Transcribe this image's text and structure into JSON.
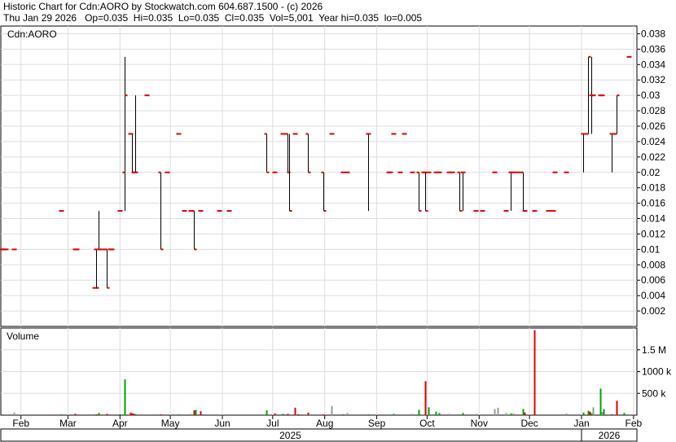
{
  "header": {
    "line1": "Historic Chart for Cdn:AORO by Stockwatch.com 604.687.1500 - (c) 2026",
    "line2": "Thu Jan 29 2026   Op=0.035  Hi=0.035  Lo=0.035  Cl=0.035  Vol=5,001  Year hi=0.035  lo=0.005"
  },
  "chart_data": {
    "type": "ohlc",
    "title": "Historic Chart for Cdn:AORO by Stockwatch.com 604.687.1500 - (c) 2026",
    "price_panel_label": "Cdn:AORO",
    "volume_panel_label": "Volume",
    "price_axis": {
      "ylim": [
        0,
        0.039
      ],
      "ticks": [
        "0.002",
        "0.004",
        "0.006",
        "0.008",
        "0.01",
        "0.012",
        "0.014",
        "0.016",
        "0.018",
        "0.02",
        "0.022",
        "0.024",
        "0.026",
        "0.028",
        "0.03",
        "0.032",
        "0.034",
        "0.036",
        "0.038"
      ]
    },
    "volume_axis": {
      "ylim": [
        0,
        2000000
      ],
      "ticks": [
        {
          "value": 500000,
          "label": "500 k"
        },
        {
          "value": 1000000,
          "label": "1000 k"
        },
        {
          "value": 1500000,
          "label": "1.5 M"
        }
      ]
    },
    "x_axis": {
      "start": "2025-01-20",
      "end": "2026-02-03",
      "months": [
        {
          "label": "Feb",
          "date": "2025-02-01"
        },
        {
          "label": "Mar",
          "date": "2025-03-01"
        },
        {
          "label": "Apr",
          "date": "2025-04-01"
        },
        {
          "label": "May",
          "date": "2025-05-01"
        },
        {
          "label": "Jun",
          "date": "2025-06-01"
        },
        {
          "label": "Jul",
          "date": "2025-07-01"
        },
        {
          "label": "Aug",
          "date": "2025-08-01"
        },
        {
          "label": "Sep",
          "date": "2025-09-01"
        },
        {
          "label": "Oct",
          "date": "2025-10-01"
        },
        {
          "label": "Nov",
          "date": "2025-11-01"
        },
        {
          "label": "Dec",
          "date": "2025-12-01"
        },
        {
          "label": "Jan",
          "date": "2026-01-01"
        },
        {
          "label": "Feb",
          "date": "2026-02-01"
        }
      ],
      "years": [
        {
          "label": "2025",
          "from": "2025-01-20",
          "to": "2025-12-31"
        },
        {
          "label": "2026",
          "from": "2026-01-01",
          "to": "2026-02-03"
        }
      ]
    },
    "grid": true,
    "colors": {
      "up": "#00a000",
      "down": "#e00000",
      "bar": "#000000",
      "grid": "#dddddd"
    },
    "bars": [
      {
        "date": "2025-01-20",
        "o": 0.01,
        "h": 0.01,
        "l": 0.01,
        "c": 0.01
      },
      {
        "date": "2025-01-21",
        "o": 0.01,
        "h": 0.01,
        "l": 0.01,
        "c": 0.01
      },
      {
        "date": "2025-01-22",
        "o": 0.01,
        "h": 0.01,
        "l": 0.01,
        "c": 0.01
      },
      {
        "date": "2025-01-23",
        "o": 0.01,
        "h": 0.01,
        "l": 0.01,
        "c": 0.01
      },
      {
        "date": "2025-01-28",
        "o": 0.01,
        "h": 0.01,
        "l": 0.01,
        "c": 0.01
      },
      {
        "date": "2025-02-25",
        "o": 0.015,
        "h": 0.015,
        "l": 0.015,
        "c": 0.015
      },
      {
        "date": "2025-03-05",
        "o": 0.01,
        "h": 0.01,
        "l": 0.01,
        "c": 0.01
      },
      {
        "date": "2025-03-06",
        "o": 0.01,
        "h": 0.01,
        "l": 0.01,
        "c": 0.01
      },
      {
        "date": "2025-03-17",
        "o": 0.005,
        "h": 0.005,
        "l": 0.005,
        "c": 0.005
      },
      {
        "date": "2025-03-18",
        "o": 0.01,
        "h": 0.01,
        "l": 0.005,
        "c": 0.005
      },
      {
        "date": "2025-03-19",
        "o": 0.01,
        "h": 0.015,
        "l": 0.01,
        "c": 0.01
      },
      {
        "date": "2025-03-21",
        "o": 0.01,
        "h": 0.01,
        "l": 0.01,
        "c": 0.01
      },
      {
        "date": "2025-03-24",
        "o": 0.01,
        "h": 0.01,
        "l": 0.005,
        "c": 0.005
      },
      {
        "date": "2025-03-26",
        "o": 0.01,
        "h": 0.01,
        "l": 0.01,
        "c": 0.01
      },
      {
        "date": "2025-03-27",
        "o": 0.01,
        "h": 0.01,
        "l": 0.01,
        "c": 0.01
      },
      {
        "date": "2025-04-01",
        "o": 0.015,
        "h": 0.015,
        "l": 0.015,
        "c": 0.015
      },
      {
        "date": "2025-04-04",
        "o": 0.02,
        "h": 0.035,
        "l": 0.015,
        "c": 0.03
      },
      {
        "date": "2025-04-07",
        "o": 0.025,
        "h": 0.025,
        "l": 0.025,
        "c": 0.025
      },
      {
        "date": "2025-04-08",
        "o": 0.025,
        "h": 0.025,
        "l": 0.02,
        "c": 0.02
      },
      {
        "date": "2025-04-09",
        "o": 0.02,
        "h": 0.02,
        "l": 0.02,
        "c": 0.02
      },
      {
        "date": "2025-04-10",
        "o": 0.02,
        "h": 0.03,
        "l": 0.02,
        "c": 0.02
      },
      {
        "date": "2025-04-17",
        "o": 0.03,
        "h": 0.03,
        "l": 0.03,
        "c": 0.03
      },
      {
        "date": "2025-04-25",
        "o": 0.02,
        "h": 0.02,
        "l": 0.01,
        "c": 0.01
      },
      {
        "date": "2025-04-29",
        "o": 0.02,
        "h": 0.02,
        "l": 0.02,
        "c": 0.02
      },
      {
        "date": "2025-05-06",
        "o": 0.025,
        "h": 0.025,
        "l": 0.025,
        "c": 0.025
      },
      {
        "date": "2025-05-09",
        "o": 0.015,
        "h": 0.015,
        "l": 0.015,
        "c": 0.015
      },
      {
        "date": "2025-05-13",
        "o": 0.015,
        "h": 0.015,
        "l": 0.015,
        "c": 0.015
      },
      {
        "date": "2025-05-15",
        "o": 0.015,
        "h": 0.015,
        "l": 0.01,
        "c": 0.01
      },
      {
        "date": "2025-05-19",
        "o": 0.015,
        "h": 0.015,
        "l": 0.015,
        "c": 0.015
      },
      {
        "date": "2025-05-30",
        "o": 0.015,
        "h": 0.015,
        "l": 0.015,
        "c": 0.015
      },
      {
        "date": "2025-06-05",
        "o": 0.015,
        "h": 0.015,
        "l": 0.015,
        "c": 0.015
      },
      {
        "date": "2025-06-27",
        "o": 0.025,
        "h": 0.025,
        "l": 0.02,
        "c": 0.02
      },
      {
        "date": "2025-07-02",
        "o": 0.02,
        "h": 0.02,
        "l": 0.02,
        "c": 0.02
      },
      {
        "date": "2025-07-07",
        "o": 0.025,
        "h": 0.025,
        "l": 0.025,
        "c": 0.025
      },
      {
        "date": "2025-07-10",
        "o": 0.025,
        "h": 0.025,
        "l": 0.02,
        "c": 0.02
      },
      {
        "date": "2025-07-11",
        "o": 0.02,
        "h": 0.025,
        "l": 0.015,
        "c": 0.015
      },
      {
        "date": "2025-07-14",
        "o": 0.025,
        "h": 0.025,
        "l": 0.025,
        "c": 0.025
      },
      {
        "date": "2025-07-22",
        "o": 0.025,
        "h": 0.025,
        "l": 0.02,
        "c": 0.02
      },
      {
        "date": "2025-07-31",
        "o": 0.02,
        "h": 0.02,
        "l": 0.015,
        "c": 0.015
      },
      {
        "date": "2025-08-05",
        "o": 0.025,
        "h": 0.025,
        "l": 0.025,
        "c": 0.025
      },
      {
        "date": "2025-08-12",
        "o": 0.02,
        "h": 0.02,
        "l": 0.02,
        "c": 0.02
      },
      {
        "date": "2025-08-14",
        "o": 0.02,
        "h": 0.02,
        "l": 0.02,
        "c": 0.02
      },
      {
        "date": "2025-08-27",
        "o": 0.025,
        "h": 0.025,
        "l": 0.015,
        "c": 0.025
      },
      {
        "date": "2025-09-11",
        "o": 0.025,
        "h": 0.025,
        "l": 0.025,
        "c": 0.025
      },
      {
        "date": "2025-09-08",
        "o": 0.02,
        "h": 0.02,
        "l": 0.02,
        "c": 0.02
      },
      {
        "date": "2025-09-09",
        "o": 0.02,
        "h": 0.02,
        "l": 0.02,
        "c": 0.02
      },
      {
        "date": "2025-09-15",
        "o": 0.02,
        "h": 0.02,
        "l": 0.02,
        "c": 0.02
      },
      {
        "date": "2025-09-17",
        "o": 0.025,
        "h": 0.025,
        "l": 0.025,
        "c": 0.025
      },
      {
        "date": "2025-09-22",
        "o": 0.02,
        "h": 0.02,
        "l": 0.02,
        "c": 0.02
      },
      {
        "date": "2025-09-26",
        "o": 0.02,
        "h": 0.02,
        "l": 0.015,
        "c": 0.015
      },
      {
        "date": "2025-09-29",
        "o": 0.02,
        "h": 0.02,
        "l": 0.02,
        "c": 0.02
      },
      {
        "date": "2025-09-30",
        "o": 0.02,
        "h": 0.02,
        "l": 0.015,
        "c": 0.015
      },
      {
        "date": "2025-10-02",
        "o": 0.02,
        "h": 0.02,
        "l": 0.02,
        "c": 0.02
      },
      {
        "date": "2025-10-06",
        "o": 0.02,
        "h": 0.02,
        "l": 0.02,
        "c": 0.02
      },
      {
        "date": "2025-10-08",
        "o": 0.02,
        "h": 0.02,
        "l": 0.02,
        "c": 0.02
      },
      {
        "date": "2025-10-14",
        "o": 0.02,
        "h": 0.02,
        "l": 0.02,
        "c": 0.02
      },
      {
        "date": "2025-10-16",
        "o": 0.02,
        "h": 0.02,
        "l": 0.02,
        "c": 0.02
      },
      {
        "date": "2025-10-20",
        "o": 0.02,
        "h": 0.02,
        "l": 0.015,
        "c": 0.015
      },
      {
        "date": "2025-10-22",
        "o": 0.02,
        "h": 0.02,
        "l": 0.015,
        "c": 0.02
      },
      {
        "date": "2025-10-30",
        "o": 0.015,
        "h": 0.015,
        "l": 0.015,
        "c": 0.015
      },
      {
        "date": "2025-11-03",
        "o": 0.015,
        "h": 0.015,
        "l": 0.015,
        "c": 0.015
      },
      {
        "date": "2025-11-10",
        "o": 0.02,
        "h": 0.02,
        "l": 0.02,
        "c": 0.02
      },
      {
        "date": "2025-11-17",
        "o": 0.015,
        "h": 0.015,
        "l": 0.015,
        "c": 0.015
      },
      {
        "date": "2025-11-20",
        "o": 0.02,
        "h": 0.02,
        "l": 0.015,
        "c": 0.02
      },
      {
        "date": "2025-11-21",
        "o": 0.02,
        "h": 0.02,
        "l": 0.02,
        "c": 0.02
      },
      {
        "date": "2025-11-24",
        "o": 0.02,
        "h": 0.02,
        "l": 0.02,
        "c": 0.02
      },
      {
        "date": "2025-11-27",
        "o": 0.02,
        "h": 0.02,
        "l": 0.015,
        "c": 0.015
      },
      {
        "date": "2025-11-28",
        "o": 0.015,
        "h": 0.015,
        "l": 0.015,
        "c": 0.015
      },
      {
        "date": "2025-12-04",
        "o": 0.015,
        "h": 0.015,
        "l": 0.015,
        "c": 0.015
      },
      {
        "date": "2025-12-12",
        "o": 0.015,
        "h": 0.015,
        "l": 0.015,
        "c": 0.015
      },
      {
        "date": "2025-12-15",
        "o": 0.015,
        "h": 0.015,
        "l": 0.015,
        "c": 0.015
      },
      {
        "date": "2025-12-16",
        "o": 0.02,
        "h": 0.02,
        "l": 0.02,
        "c": 0.02
      },
      {
        "date": "2025-12-23",
        "o": 0.02,
        "h": 0.02,
        "l": 0.02,
        "c": 0.02
      },
      {
        "date": "2026-01-02",
        "o": 0.025,
        "h": 0.025,
        "l": 0.02,
        "c": 0.025
      },
      {
        "date": "2026-01-05",
        "o": 0.025,
        "h": 0.035,
        "l": 0.025,
        "c": 0.035
      },
      {
        "date": "2026-01-07",
        "o": 0.03,
        "h": 0.035,
        "l": 0.025,
        "c": 0.03
      },
      {
        "date": "2026-01-08",
        "o": 0.03,
        "h": 0.03,
        "l": 0.03,
        "c": 0.03
      },
      {
        "date": "2026-01-12",
        "o": 0.03,
        "h": 0.03,
        "l": 0.03,
        "c": 0.03
      },
      {
        "date": "2026-01-13",
        "o": 0.03,
        "h": 0.03,
        "l": 0.03,
        "c": 0.03
      },
      {
        "date": "2026-01-19",
        "o": 0.025,
        "h": 0.025,
        "l": 0.02,
        "c": 0.025
      },
      {
        "date": "2026-01-22",
        "o": 0.025,
        "h": 0.03,
        "l": 0.025,
        "c": 0.03
      },
      {
        "date": "2026-01-29",
        "o": 0.035,
        "h": 0.035,
        "l": 0.035,
        "c": 0.035
      }
    ],
    "volumes": [
      {
        "date": "2025-01-23",
        "v": 20000,
        "dir": "flat"
      },
      {
        "date": "2025-01-28",
        "v": 60000,
        "dir": "flat"
      },
      {
        "date": "2025-02-25",
        "v": 20000,
        "dir": "up"
      },
      {
        "date": "2025-03-05",
        "v": 30000,
        "dir": "down"
      },
      {
        "date": "2025-03-18",
        "v": 20000,
        "dir": "down"
      },
      {
        "date": "2025-03-19",
        "v": 50000,
        "dir": "up"
      },
      {
        "date": "2025-03-21",
        "v": 25000,
        "dir": "flat"
      },
      {
        "date": "2025-03-24",
        "v": 30000,
        "dir": "down"
      },
      {
        "date": "2025-04-01",
        "v": 20000,
        "dir": "up"
      },
      {
        "date": "2025-04-04",
        "v": 820000,
        "dir": "up"
      },
      {
        "date": "2025-04-07",
        "v": 60000,
        "dir": "down"
      },
      {
        "date": "2025-04-08",
        "v": 40000,
        "dir": "down"
      },
      {
        "date": "2025-04-09",
        "v": 30000,
        "dir": "down"
      },
      {
        "date": "2025-04-10",
        "v": 25000,
        "dir": "up"
      },
      {
        "date": "2025-04-25",
        "v": 20000,
        "dir": "down"
      },
      {
        "date": "2025-05-06",
        "v": 20000,
        "dir": "up"
      },
      {
        "date": "2025-05-13",
        "v": 30000,
        "dir": "flat"
      },
      {
        "date": "2025-05-15",
        "v": 110000,
        "dir": "down"
      },
      {
        "date": "2025-05-16",
        "v": 120000,
        "dir": "up"
      },
      {
        "date": "2025-05-19",
        "v": 90000,
        "dir": "down"
      },
      {
        "date": "2025-05-30",
        "v": 20000,
        "dir": "flat"
      },
      {
        "date": "2025-06-27",
        "v": 110000,
        "dir": "up"
      },
      {
        "date": "2025-07-02",
        "v": 40000,
        "dir": "down"
      },
      {
        "date": "2025-07-07",
        "v": 30000,
        "dir": "up"
      },
      {
        "date": "2025-07-10",
        "v": 30000,
        "dir": "down"
      },
      {
        "date": "2025-07-14",
        "v": 170000,
        "dir": "down"
      },
      {
        "date": "2025-07-16",
        "v": 20000,
        "dir": "down"
      },
      {
        "date": "2025-07-22",
        "v": 60000,
        "dir": "down"
      },
      {
        "date": "2025-07-31",
        "v": 20000,
        "dir": "down"
      },
      {
        "date": "2025-08-05",
        "v": 210000,
        "dir": "flat"
      },
      {
        "date": "2025-08-12",
        "v": 20000,
        "dir": "up"
      },
      {
        "date": "2025-08-14",
        "v": 50000,
        "dir": "flat"
      },
      {
        "date": "2025-08-27",
        "v": 20000,
        "dir": "up"
      },
      {
        "date": "2025-09-11",
        "v": 30000,
        "dir": "up"
      },
      {
        "date": "2025-09-22",
        "v": 30000,
        "dir": "flat"
      },
      {
        "date": "2025-09-26",
        "v": 120000,
        "dir": "up"
      },
      {
        "date": "2025-09-29",
        "v": 20000,
        "dir": "flat"
      },
      {
        "date": "2025-09-30",
        "v": 780000,
        "dir": "down"
      },
      {
        "date": "2025-10-02",
        "v": 180000,
        "dir": "up"
      },
      {
        "date": "2025-10-06",
        "v": 80000,
        "dir": "up"
      },
      {
        "date": "2025-10-08",
        "v": 50000,
        "dir": "up"
      },
      {
        "date": "2025-10-14",
        "v": 30000,
        "dir": "flat"
      },
      {
        "date": "2025-10-22",
        "v": 50000,
        "dir": "up"
      },
      {
        "date": "2025-10-30",
        "v": 30000,
        "dir": "flat"
      },
      {
        "date": "2025-11-10",
        "v": 140000,
        "dir": "flat"
      },
      {
        "date": "2025-11-12",
        "v": 170000,
        "dir": "flat"
      },
      {
        "date": "2025-11-17",
        "v": 50000,
        "dir": "flat"
      },
      {
        "date": "2025-11-20",
        "v": 40000,
        "dir": "up"
      },
      {
        "date": "2025-11-21",
        "v": 40000,
        "dir": "flat"
      },
      {
        "date": "2025-11-27",
        "v": 140000,
        "dir": "up"
      },
      {
        "date": "2025-11-28",
        "v": 60000,
        "dir": "down"
      },
      {
        "date": "2025-12-04",
        "v": 1950000,
        "dir": "down"
      },
      {
        "date": "2025-12-23",
        "v": 40000,
        "dir": "flat"
      },
      {
        "date": "2026-01-02",
        "v": 60000,
        "dir": "up"
      },
      {
        "date": "2026-01-05",
        "v": 100000,
        "dir": "up"
      },
      {
        "date": "2026-01-06",
        "v": 80000,
        "dir": "down"
      },
      {
        "date": "2026-01-07",
        "v": 40000,
        "dir": "up"
      },
      {
        "date": "2026-01-08",
        "v": 180000,
        "dir": "flat"
      },
      {
        "date": "2026-01-12",
        "v": 610000,
        "dir": "up"
      },
      {
        "date": "2026-01-13",
        "v": 70000,
        "dir": "flat"
      },
      {
        "date": "2026-01-14",
        "v": 140000,
        "dir": "up"
      },
      {
        "date": "2026-01-19",
        "v": 20000,
        "dir": "down"
      },
      {
        "date": "2026-01-22",
        "v": 330000,
        "dir": "down"
      },
      {
        "date": "2026-01-26",
        "v": 50000,
        "dir": "up"
      },
      {
        "date": "2026-01-29",
        "v": 20000,
        "dir": "flat"
      }
    ]
  }
}
